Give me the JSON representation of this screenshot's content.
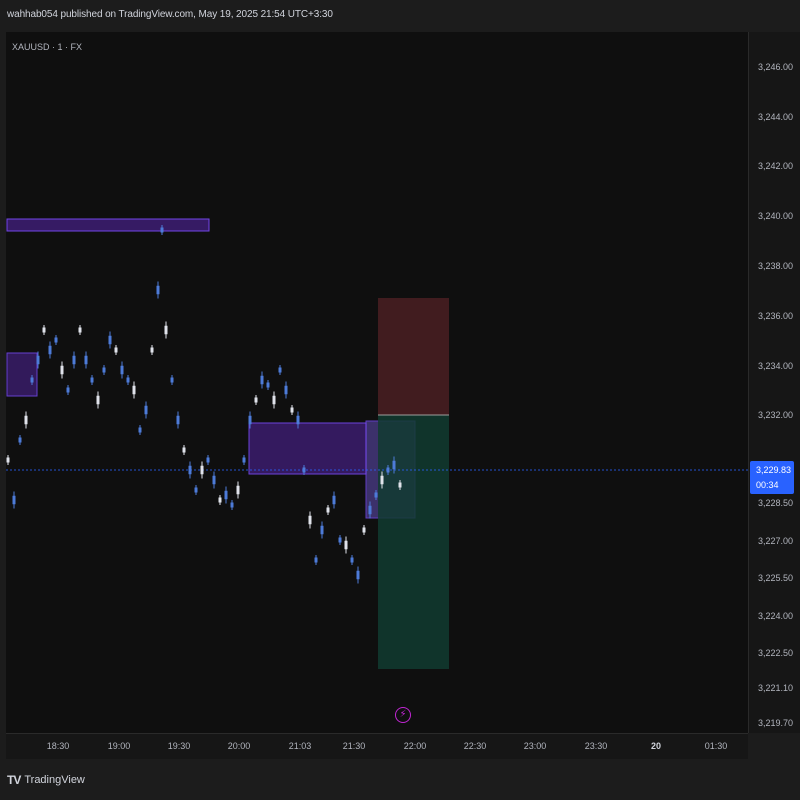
{
  "header": {
    "published_text": "wahhab054 published on TradingView.com, May 19, 2025 21:54 UTC+3:30"
  },
  "chart": {
    "symbol": "XAUUSD · 1 · FX"
  },
  "price_axis": {
    "labels": [
      "3,246.00",
      "3,244.00",
      "3,242.00",
      "3,240.00",
      "3,238.00",
      "3,236.00",
      "3,234.00",
      "3,232.00",
      "3,228.50",
      "3,227.00",
      "3,225.50",
      "3,224.00",
      "3,222.50",
      "3,221.10",
      "3,219.70"
    ],
    "current_price": "3,229.83",
    "countdown": "00:34"
  },
  "time_axis": {
    "labels": [
      "18:30",
      "19:00",
      "19:30",
      "20:00",
      "21:03",
      "21:30",
      "22:00",
      "22:30",
      "23:00",
      "23:30",
      "20",
      "01:30"
    ]
  },
  "footer": {
    "brand": "TradingView",
    "logo": "TV"
  },
  "colors": {
    "accent": "#2962ff",
    "candle": "#4d7bd8",
    "zone": "#5b2a9e",
    "stop": "#5a2022",
    "target": "#134e3a"
  },
  "icons": {
    "alert": "bolt-icon"
  }
}
